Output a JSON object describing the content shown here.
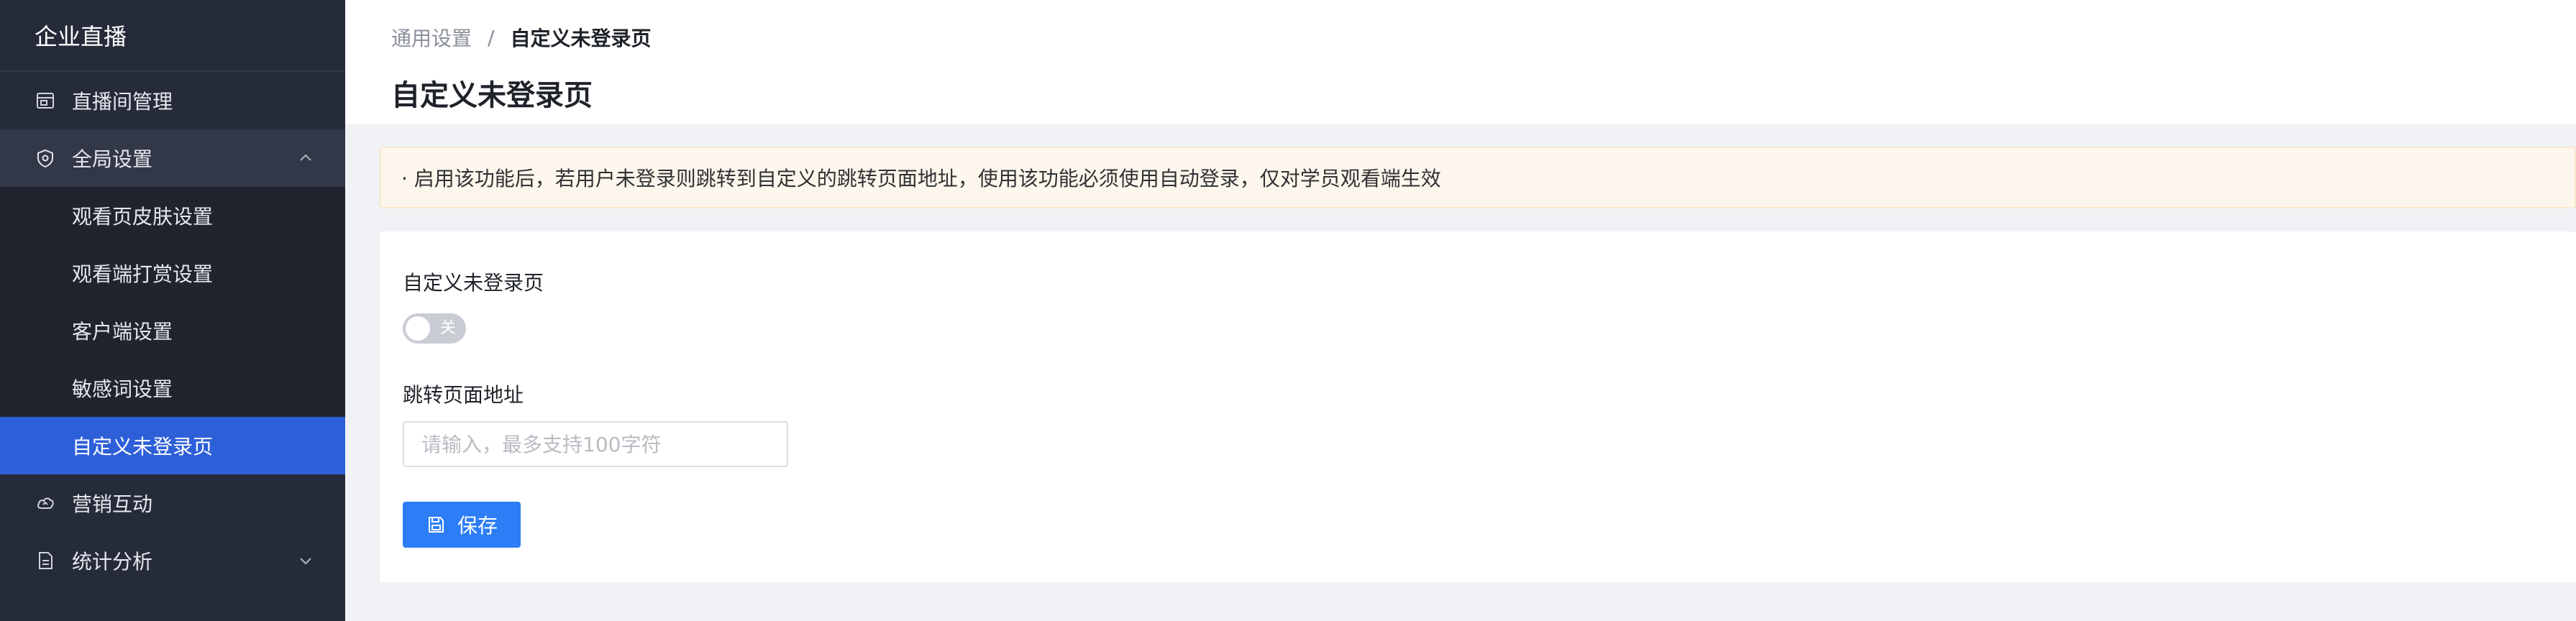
{
  "sidebar": {
    "brand": "企业直播",
    "items": [
      {
        "label": "直播间管理",
        "icon": "monitor-icon"
      },
      {
        "label": "全局设置",
        "icon": "shield-icon",
        "expanded": true
      },
      {
        "label": "营销互动",
        "icon": "cloud-icon"
      },
      {
        "label": "统计分析",
        "icon": "document-icon",
        "expanded": false
      }
    ],
    "submenu": [
      {
        "label": "观看页皮肤设置"
      },
      {
        "label": "观看端打赏设置"
      },
      {
        "label": "客户端设置"
      },
      {
        "label": "敏感词设置"
      },
      {
        "label": "自定义未登录页",
        "active": true
      }
    ]
  },
  "breadcrumb": {
    "parent": "通用设置",
    "separator": "/",
    "current": "自定义未登录页"
  },
  "page": {
    "title": "自定义未登录页"
  },
  "notice": {
    "text": "· 启用该功能后，若用户未登录则跳转到自定义的跳转页面地址，使用该功能必须使用自动登录，仅对学员观看端生效"
  },
  "form": {
    "toggle_label": "自定义未登录页",
    "toggle_state_text": "关",
    "url_label": "跳转页面地址",
    "url_value": "",
    "url_placeholder": "请输入，最多支持100字符",
    "save_label": "保存"
  },
  "colors": {
    "sidebar_bg": "#262b3a",
    "active_item": "#2d5fd8",
    "primary_button": "#2d7df6",
    "notice_bg": "#fdf6ec",
    "toggle_off": "#c9ccd3"
  }
}
